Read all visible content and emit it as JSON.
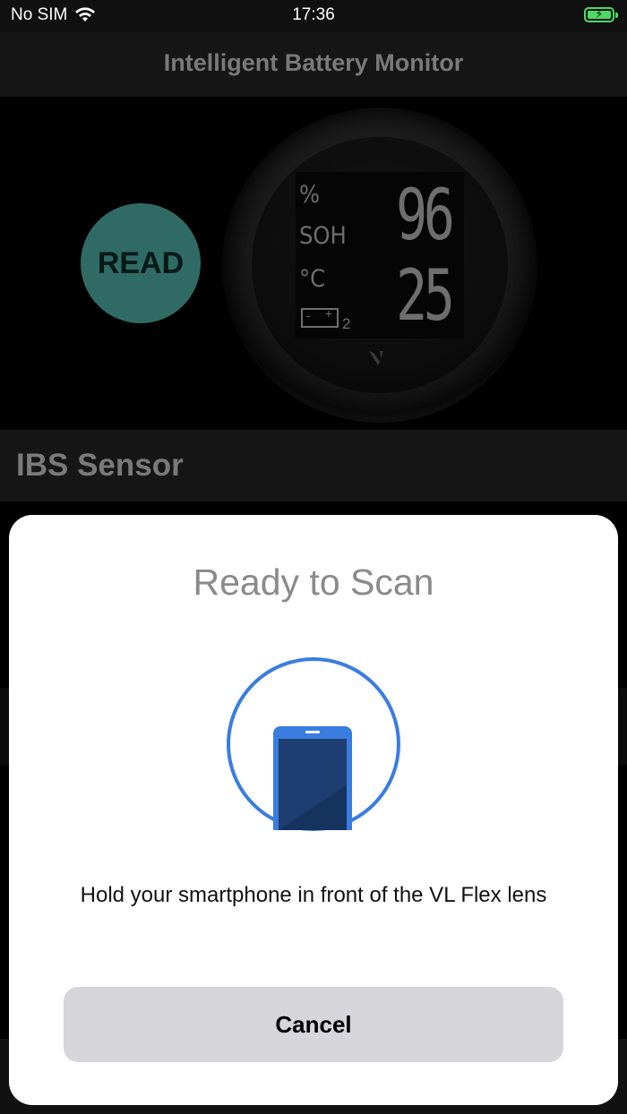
{
  "status_bar": {
    "carrier": "No SIM",
    "time": "17:36",
    "wifi_icon": "wifi-icon",
    "battery_icon": "battery-charging-icon",
    "battery_color": "#4cd964"
  },
  "nav": {
    "title": "Intelligent Battery Monitor"
  },
  "hero": {
    "read_label": "READ",
    "read_color": "#2f6b64",
    "display": {
      "percent_unit": "%",
      "soh_label": "SOH",
      "temp_unit": "°C",
      "battery_index": "2",
      "soh_value": "96",
      "temp_value": "25"
    }
  },
  "section": {
    "title": "IBS Sensor"
  },
  "scan_sheet": {
    "title": "Ready to Scan",
    "message": "Hold your smartphone in front of the VL Flex lens",
    "cancel_label": "Cancel",
    "accent_color": "#3a7de0",
    "icon": "phone-icon"
  }
}
